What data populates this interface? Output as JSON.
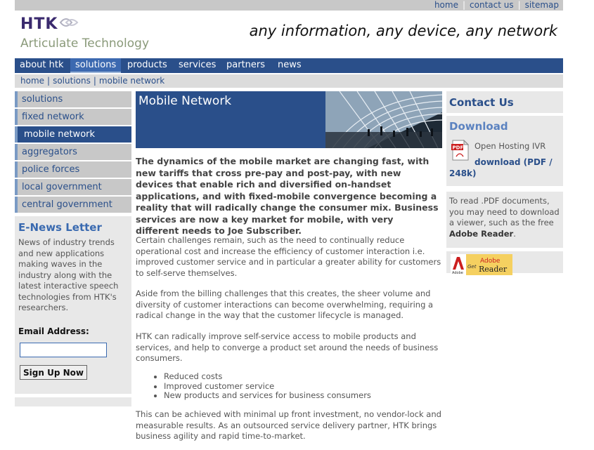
{
  "top_links": [
    "home",
    "contact us",
    "sitemap"
  ],
  "logo": {
    "text": "HTK",
    "subtitle": "Articulate Technology"
  },
  "tagline": "any information, any device, any network",
  "nav": [
    "about htk",
    "solutions",
    "products",
    "services",
    "partners",
    "news"
  ],
  "nav_active": "solutions",
  "breadcrumb": [
    "home",
    "solutions",
    "mobile network"
  ],
  "left_nav": [
    "solutions",
    "fixed network",
    "mobile network",
    "aggregators",
    "police forces",
    "local government",
    "central government"
  ],
  "left_nav_active": "mobile network",
  "enews": {
    "title": "E-News Letter",
    "text": "News of industry trends and new applications making waves in the industry along with the latest interactive speech technologies from HTK's researchers.",
    "email_label": "Email Address:",
    "email_value": "",
    "button": "Sign Up Now"
  },
  "main": {
    "title": "Mobile Network",
    "lead": "The dynamics of the mobile market are changing fast, with new tariffs that cross pre-pay and post-pay, with new devices that enable rich and diversified on-handset applications, and with fixed-mobile convergence becoming a reality that will radically change the consumer mix. Business services are now a key market for mobile, with very different needs to Joe Subscriber.",
    "p1": "Certain challenges remain, such as the need to continually reduce operational cost and increase the efficiency of customer interaction i.e. improved customer service and in particular a greater ability for customers to self-serve themselves.",
    "p2": "Aside from the billing challenges that this creates, the sheer volume and diversity of customer interactions can become overwhelming, requiring a radical change in the way that the customer lifecycle is managed.",
    "p3": "HTK can radically improve self-service access to mobile products and services, and help to converge a product set around the needs of business consumers.",
    "bullets": [
      "Reduced costs",
      "Improved customer service",
      "New products and services for business consumers"
    ],
    "p4": "This can be achieved with minimal up front investment, no vendor-lock and measurable results. As an outsourced service delivery partner, HTK brings business agility and rapid time-to-market."
  },
  "right": {
    "contact_title": "Contact Us",
    "download_title": "Download",
    "pdf_title": "Open Hosting IVR",
    "pdf_link": "download (PDF / 248k)",
    "pdf_icon_label": "PDF",
    "read_text_pre": "To read .PDF documents, you may need to download a viewer, such as the free ",
    "read_text_bold": "Adobe Reader",
    "read_text_post": ".",
    "adobe_badge": {
      "get": "Get",
      "adobe": "Adobe",
      "reader": "Reader",
      "mark": "Adobe"
    }
  },
  "colors": {
    "brand_blue": "#2a4f8a",
    "heading_blue": "#3a6ab0",
    "panel_gray": "#e8e8e8",
    "nav_gray": "#c8c8c8"
  }
}
